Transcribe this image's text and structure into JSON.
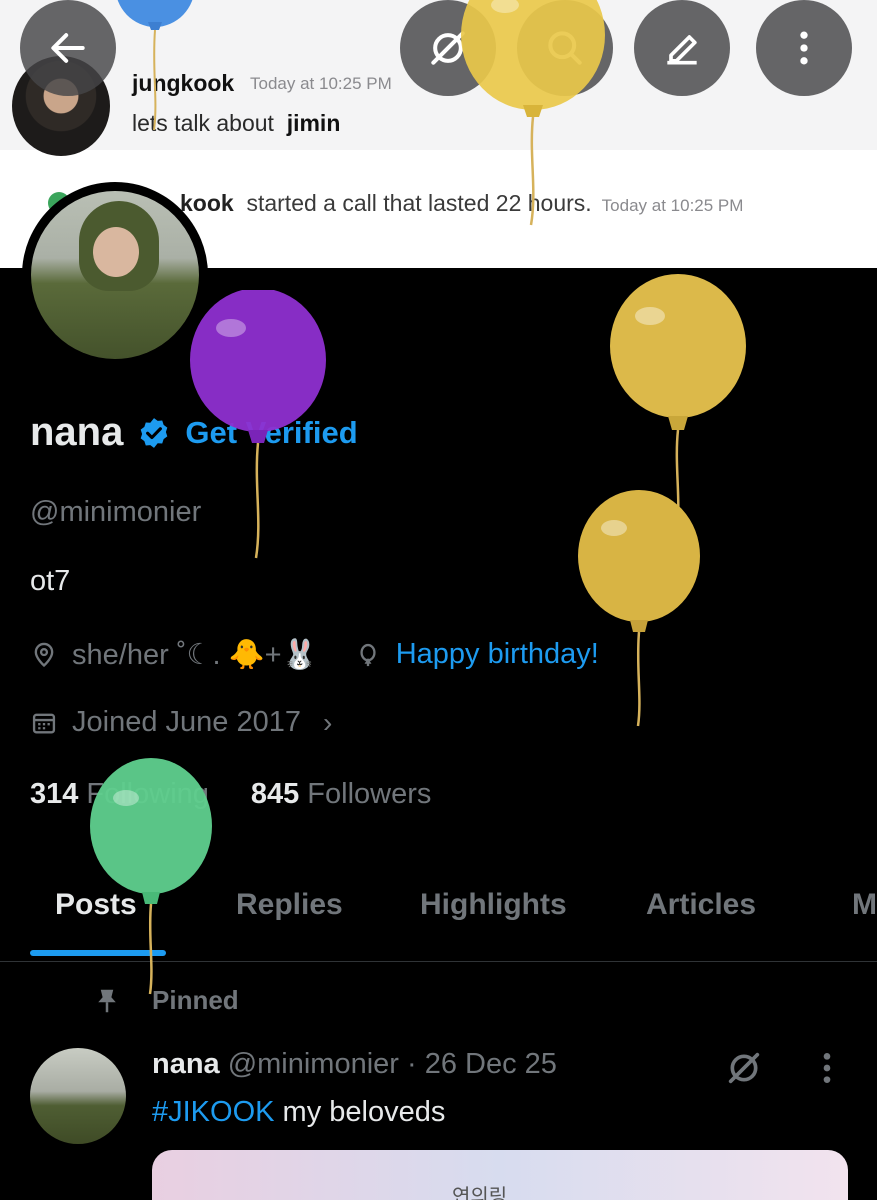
{
  "banner": {
    "message": {
      "author": "jungkook",
      "time": "Today at 10:25 PM",
      "text_prefix": "lets talk about",
      "text_mention": "jimin"
    },
    "call": {
      "who": "kook",
      "text": "started a call that lasted 22 hours.",
      "time": "Today at 10:25 PM"
    }
  },
  "top_buttons": [
    "back-icon",
    "grok-icon",
    "search-icon",
    "edit-icon",
    "more-vertical-icon"
  ],
  "profile": {
    "name": "nana",
    "get_verified": "Get Verified",
    "handle": "@minimonier",
    "bio": "ot7",
    "location": "she/her ˚☾. 🐥+🐰",
    "website": "Happy birthday!",
    "joined": "Joined June 2017",
    "following_count": "314",
    "following_label": "Following",
    "followers_count": "845",
    "followers_label": "Followers"
  },
  "tabs": [
    {
      "label": "Posts",
      "active": true
    },
    {
      "label": "Replies",
      "active": false
    },
    {
      "label": "Highlights",
      "active": false
    },
    {
      "label": "Articles",
      "active": false
    },
    {
      "label": "M",
      "active": false
    }
  ],
  "pinned_post": {
    "pinned_label": "Pinned",
    "author_name": "nana",
    "author_handle": "@minimonier",
    "date": "· 26 Dec 25",
    "hashtag": "#JIKOOK",
    "text": " my beloveds",
    "media_text": "연의링"
  },
  "colors": {
    "accent": "#1d9bf0",
    "background": "#000000",
    "text_primary": "#e7e9ea",
    "text_secondary": "#71767b"
  }
}
